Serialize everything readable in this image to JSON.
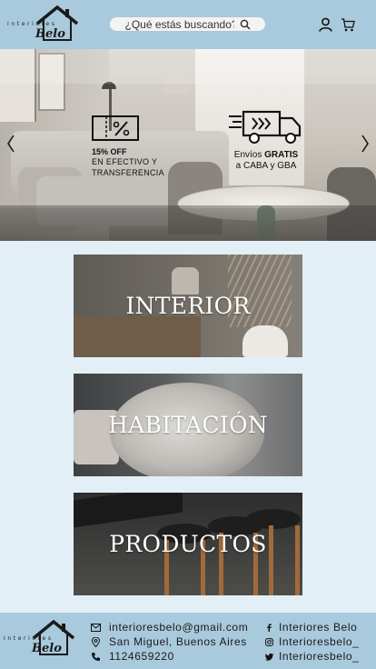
{
  "brand": {
    "small_text": "Interiores",
    "script_text": "Belo"
  },
  "header": {
    "search_placeholder": "¿Qué estás buscando?",
    "icons": [
      "search-icon",
      "user-icon",
      "cart-icon"
    ]
  },
  "hero": {
    "promo_discount": {
      "title": "15% OFF",
      "line2": "EN EFECTIVO Y",
      "line3": "TRANSFERENCIA",
      "icon": "discount-coupon-icon"
    },
    "promo_shipping": {
      "prefix": "Envíos ",
      "bold": "GRATIS",
      "line2": "a CABA y GBA",
      "icon": "delivery-truck-icon"
    },
    "arrows": [
      "chevron-left-icon",
      "chevron-right-icon"
    ]
  },
  "categories": [
    {
      "label": "INTERIOR"
    },
    {
      "label": "HABITACIÓN"
    },
    {
      "label": "PRODUCTOS"
    }
  ],
  "footer": {
    "email": "interioresbelo@gmail.com",
    "address": "San Miguel, Buenos Aires",
    "phone": "1124659220",
    "facebook": "Interiores Belo",
    "instagram": "Interioresbelo_",
    "twitter": "Interioresbelo_"
  },
  "colors": {
    "header_bg": "#a9c9dc",
    "page_bg": "#e2eff6",
    "text_dark": "#1a1a1a",
    "card_text": "#ffffff"
  }
}
